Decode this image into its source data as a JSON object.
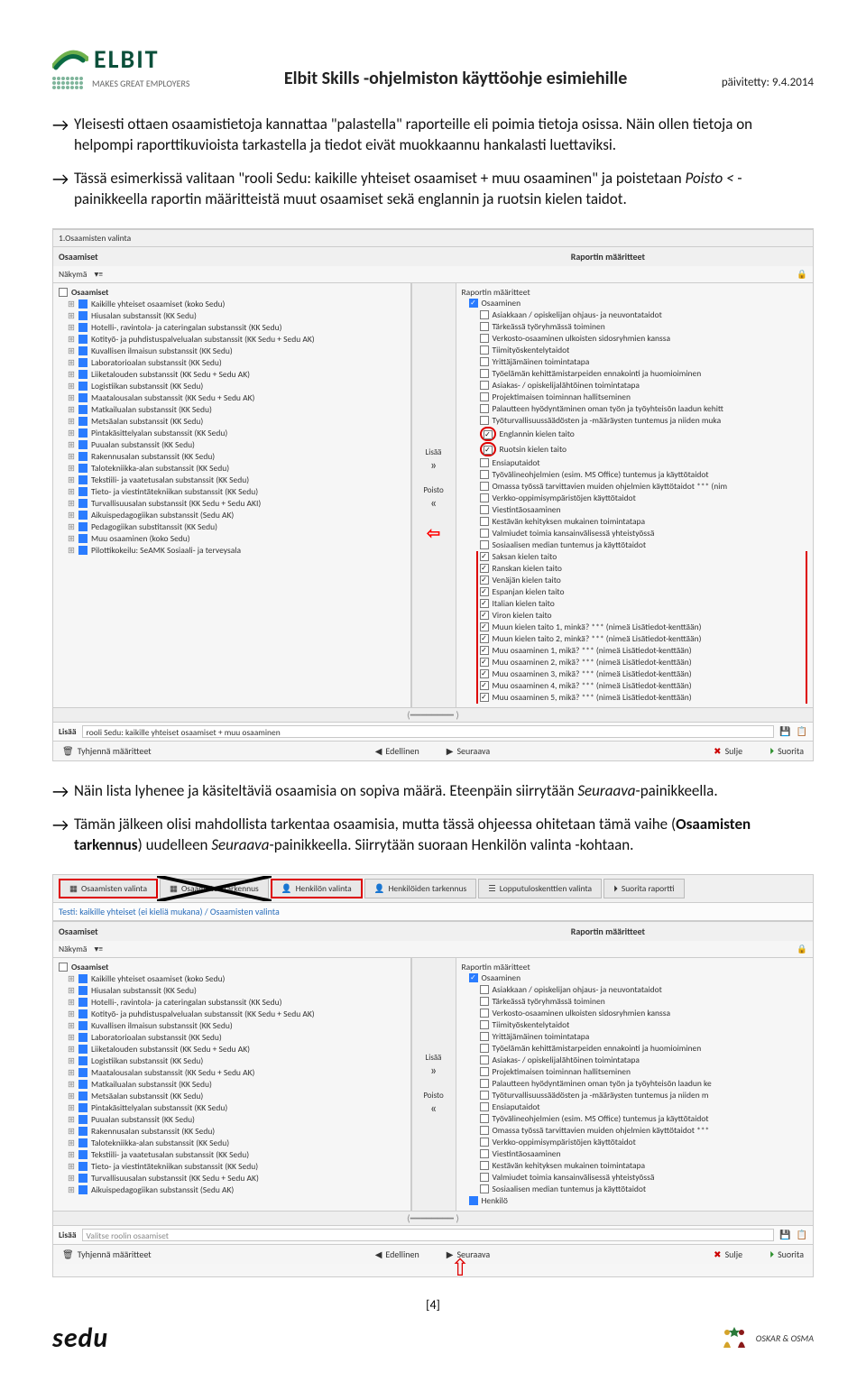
{
  "header": {
    "brand": "ELBIT",
    "tagline": "MAKES GREAT EMPLOYERS",
    "doc_title": "Elbit Skills -ohjelmiston käyttöohje esimiehille",
    "updated": "päivitetty: 9.4.2014"
  },
  "para1": "Yleisesti ottaen osaamistietoja kannattaa \"palastella\" raporteille eli poimia tietoja osissa. Näin ollen tietoja on helpompi raporttikuvioista tarkastella ja tiedot eivät muokkaannu hankalasti luettaviksi.",
  "para2_a": "Tässä esimerkissä valitaan \"rooli Sedu: kaikille yhteiset osaamiset + muu osaaminen\" ja poistetaan ",
  "para2_b": "Poisto < ",
  "para2_c": "-painikkeella raportin määritteistä muut osaamiset sekä englannin ja ruotsin kielen taidot.",
  "shot1": {
    "title_row": "1.Osaamisten valinta",
    "left_header": "Osaamiset",
    "right_header": "Raportin määritteet",
    "nakyma_label": "Näkymä",
    "osaamiset_root": "Osaamiset",
    "left_items": [
      "Kaikille yhteiset osaamiset (koko Sedu)",
      "Hiusalan substanssit (KK Sedu)",
      "Hotelli-, ravintola- ja cateringalan substanssit (KK Sedu)",
      "Kotityö- ja puhdistuspalvelualan substanssit (KK Sedu + Sedu AK)",
      "Kuvallisen ilmaisun substanssit (KK Sedu)",
      "Laboratorioalan substanssit (KK Sedu)",
      "Liiketalouden substanssit (KK Sedu + Sedu AK)",
      "Logistiikan substanssit (KK Sedu)",
      "Maatalousalan substanssit (KK Sedu + Sedu AK)",
      "Matkailualan substanssit (KK Sedu)",
      "Metsäalan substanssit (KK Sedu)",
      "Pintakäsittelyalan substanssit (KK Sedu)",
      "Puualan substanssit (KK Sedu)",
      "Rakennusalan substanssit (KK Sedu)",
      "Talotekniikka-alan substanssit (KK Sedu)",
      "Tekstiili- ja vaatetusalan substanssit (KK Sedu)",
      "Tieto- ja viestintätekniikan substanssit (KK Sedu)",
      "Turvallisuusalan substanssit (KK Sedu + Sedu AKI)",
      "Aikuispedagogiikan substanssit (Sedu AK)",
      "Pedagogiikan substitanssit (KK Sedu)",
      "Muu osaaminen (koko Sedu)",
      "Pilottikokeilu: SeAMK Sosiaali- ja terveysala"
    ],
    "right_root1": "Raportin määritteet",
    "right_root2": "Osaaminen",
    "right_items": [
      {
        "t": "Asiakkaan / opiskelijan ohjaus- ja neuvontataidot",
        "c": false
      },
      {
        "t": "Tärkeässä työryhmässä toiminen",
        "c": false
      },
      {
        "t": "Verkosto-osaaminen ulkoisten sidosryhmien kanssa",
        "c": false
      },
      {
        "t": "Tiimityöskentelytaidot",
        "c": false
      },
      {
        "t": "Yrittäjämäinen toimintatapa",
        "c": false
      },
      {
        "t": "Työelämän kehittämistarpeiden ennakointi ja huomioiminen",
        "c": false
      },
      {
        "t": "Asiakas- / opiskelijalähtöinen toimintatapa",
        "c": false
      },
      {
        "t": "Projektimaisen toiminnan hallitseminen",
        "c": false
      },
      {
        "t": "Palautteen hyödyntäminen oman työn ja työyhteisön laadun kehitt",
        "c": false
      },
      {
        "t": "Työturvallisuussäädösten ja -määräysten tuntemus ja niiden muka",
        "c": false
      },
      {
        "t": "Englannin kielen taito",
        "c": true,
        "circ": true
      },
      {
        "t": "Ruotsin kielen taito",
        "c": true,
        "circ": true
      },
      {
        "t": "Ensiaputaidot",
        "c": false
      },
      {
        "t": "Työvälineohjelmien (esim. MS Office) tuntemus ja käyttötaidot",
        "c": false
      },
      {
        "t": "Omassa työssä tarvittavien muiden ohjelmien käyttötaidot *** (nim",
        "c": false
      },
      {
        "t": "Verkko-oppimisympäristöjen käyttötaidot",
        "c": false
      },
      {
        "t": "Viestintäosaaminen",
        "c": false
      },
      {
        "t": "Kestävän kehityksen mukainen toimintatapa",
        "c": false
      },
      {
        "t": "Valmiudet toimia kansainvälisessä yhteistyössä",
        "c": false
      },
      {
        "t": "Sosiaalisen median tuntemus ja käyttötaidot",
        "c": false
      },
      {
        "t": "Saksan kielen taito",
        "c": true,
        "red": true
      },
      {
        "t": "Ranskan kielen taito",
        "c": true,
        "red": true
      },
      {
        "t": "Venäjän kielen taito",
        "c": true,
        "red": true
      },
      {
        "t": "Espanjan kielen taito",
        "c": true,
        "red": true
      },
      {
        "t": "Italian kielen taito",
        "c": true,
        "red": true
      },
      {
        "t": "Viron kielen taito",
        "c": true,
        "red": true
      },
      {
        "t": "Muun kielen taito 1, minkä? *** (nimeä Lisätiedot-kenttään)",
        "c": true,
        "red": true
      },
      {
        "t": "Muun kielen taito 2, minkä? *** (nimeä Lisätiedot-kenttään)",
        "c": true,
        "red": true
      },
      {
        "t": "Muu osaaminen 1, mikä? *** (nimeä Lisätiedot-kenttään)",
        "c": true,
        "red": true
      },
      {
        "t": "Muu osaaminen 2, mikä? *** (nimeä Lisätiedot-kenttään)",
        "c": true,
        "red": true
      },
      {
        "t": "Muu osaaminen 3, mikä? *** (nimeä Lisätiedot-kenttään)",
        "c": true,
        "red": true
      },
      {
        "t": "Muu osaaminen 4, mikä? *** (nimeä Lisätiedot-kenttään)",
        "c": true,
        "red": true
      },
      {
        "t": "Muu osaaminen 5, mikä? *** (nimeä Lisätiedot-kenttään)",
        "c": true,
        "red": true
      }
    ],
    "lisaa_label": "Lisää",
    "poisto_label": "Poisto",
    "lisaa_row_label": "Lisää",
    "lisaa_value": "rooli Sedu: kaikille yhteiset osaamiset + muu osaaminen",
    "footer": {
      "tyhjenna": "Tyhjennä määritteet",
      "edellinen": "Edellinen",
      "seuraava": "Seuraava",
      "sulje": "Sulje",
      "suorita": "Suorita"
    }
  },
  "para3_a": "Näin lista lyhenee ja käsiteltäviä osaamisia on sopiva määrä. Eteenpäin siirrytään ",
  "para3_b": "Seuraava",
  "para3_c": "-painikkeella.",
  "para4_a": "Tämän jälkeen olisi mahdollista tarkentaa osaamisia, mutta tässä ohjeessa ohitetaan tämä vaihe (",
  "para4_b": "Osaamisten tarkennus",
  "para4_c": ") uudelleen ",
  "para4_d": "Seuraava",
  "para4_e": "-painikkeella. Siirrytään suoraan Henkilön valinta -kohtaan.",
  "shot2": {
    "tabs": [
      "Osaamisten valinta",
      "Osaamisten tarkennus",
      "Henkilön valinta",
      "Henkilöiden tarkennus",
      "Lopputuloskenttien valinta",
      "Suorita raportti"
    ],
    "breadcrumb": "Testi: kaikille yhteiset (ei kieliä mukana) / Osaamisten valinta",
    "left_header": "Osaamiset",
    "right_header": "Raportin määritteet",
    "nakyma_label": "Näkymä",
    "osaamiset_root": "Osaamiset",
    "left_items": [
      "Kaikille yhteiset osaamiset (koko Sedu)",
      "Hiusalan substanssit (KK Sedu)",
      "Hotelli-, ravintola- ja cateringalan substanssit (KK Sedu)",
      "Kotityö- ja puhdistuspalvelualan substanssit (KK Sedu + Sedu AK)",
      "Kuvallisen ilmaisun substanssit (KK Sedu)",
      "Laboratorioalan substanssit (KK Sedu)",
      "Liiketalouden substanssit (KK Sedu + Sedu AK)",
      "Logistiikan substanssit (KK Sedu)",
      "Maatalousalan substanssit (KK Sedu + Sedu AK)",
      "Matkailualan substanssit (KK Sedu)",
      "Metsäalan substanssit (KK Sedu)",
      "Pintakäsittelyalan substanssit (KK Sedu)",
      "Puualan substanssit (KK Sedu)",
      "Rakennusalan substanssit (KK Sedu)",
      "Talotekniikka-alan substanssit (KK Sedu)",
      "Tekstiili- ja vaatetusalan substanssit (KK Sedu)",
      "Tieto- ja viestintätekniikan substanssit (KK Sedu)",
      "Turvallisuusalan substanssit (KK Sedu + Sedu AK)",
      "Aikuispedagogiikan substanssit (Sedu AK)"
    ],
    "right_root1": "Raportin määritteet",
    "right_root2": "Osaaminen",
    "right_items": [
      "Asiakkaan / opiskelijan ohjaus- ja neuvontataidot",
      "Tärkeässä työryhmässä toiminen",
      "Verkosto-osaaminen ulkoisten sidosryhmien kanssa",
      "Tiimityöskentelytaidot",
      "Yrittäjämäinen toimintatapa",
      "Työelämän kehittämistarpeiden ennakointi ja huomioiminen",
      "Asiakas- / opiskelijalähtöinen toimintatapa",
      "Projektimaisen toiminnan hallitseminen",
      "Palautteen hyödyntäminen oman työn ja työyhteisön laadun ke",
      "Työturvallisuussäädösten ja -määräysten tuntemus ja niiden m",
      "Ensiaputaidot",
      "Työvälineohjelmien (esim. MS Office) tuntemus ja käyttötaidot",
      "Omassa työssä tarvittavien muiden ohjelmien käyttötaidot ***",
      "Verkko-oppimisympäristöjen käyttötaidot",
      "Viestintäosaaminen",
      "Kestävän kehityksen mukainen toimintatapa",
      "Valmiudet toimia kansainvälisessä yhteistyössä",
      "Sosiaalisen median tuntemus ja käyttötaidot"
    ],
    "henkilo_label": "Henkilö",
    "lisaa_label": "Lisää",
    "poisto_label": "Poisto",
    "lisaa_row_label": "Lisää",
    "lisaa_value": "Valitse roolin osaamiset",
    "footer": {
      "tyhjenna": "Tyhjennä määritteet",
      "edellinen": "Edellinen",
      "seuraava": "Seuraava",
      "sulje": "Sulje",
      "suorita": "Suorita"
    }
  },
  "page_num": "[4]",
  "footer_logos": {
    "sedu": "sedu",
    "oskar": "OSKAR & OSMA"
  }
}
